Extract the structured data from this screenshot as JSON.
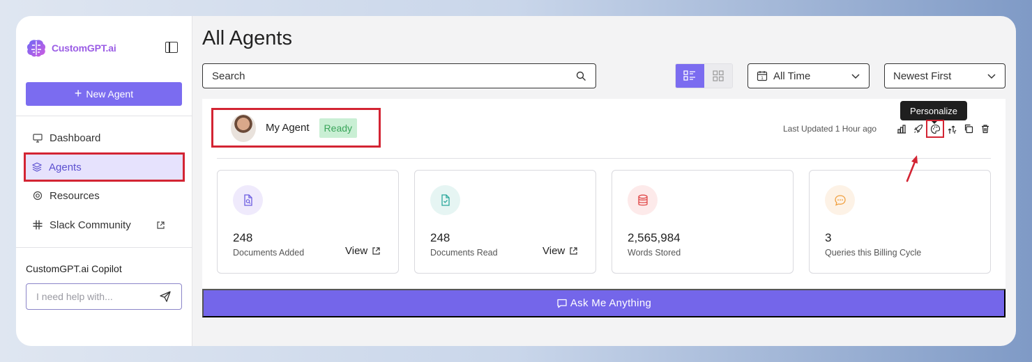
{
  "brand": {
    "name": "CustomGPT.ai",
    "accent": "#7b6cf0"
  },
  "sidebar": {
    "new_agent_label": "New Agent",
    "items": [
      {
        "label": "Dashboard",
        "icon": "monitor-icon"
      },
      {
        "label": "Agents",
        "icon": "layers-icon",
        "active": true
      },
      {
        "label": "Resources",
        "icon": "lifebuoy-icon"
      },
      {
        "label": "Slack Community",
        "icon": "slack-icon",
        "external": true
      }
    ],
    "copilot": {
      "label": "CustomGPT.ai Copilot",
      "placeholder": "I need help with..."
    }
  },
  "main": {
    "title": "All Agents",
    "search_placeholder": "Search",
    "filter_time": "All Time",
    "sort": "Newest First"
  },
  "agent": {
    "name": "My Agent",
    "status": "Ready",
    "last_updated": "Last Updated 1 Hour ago",
    "tooltip": "Personalize",
    "stats": [
      {
        "value": "248",
        "label": "Documents Added",
        "link": "View"
      },
      {
        "value": "248",
        "label": "Documents Read",
        "link": "View"
      },
      {
        "value": "2,565,984",
        "label": "Words Stored"
      },
      {
        "value": "3",
        "label": "Queries this Billing Cycle"
      }
    ],
    "ask_label": "Ask Me Anything"
  }
}
